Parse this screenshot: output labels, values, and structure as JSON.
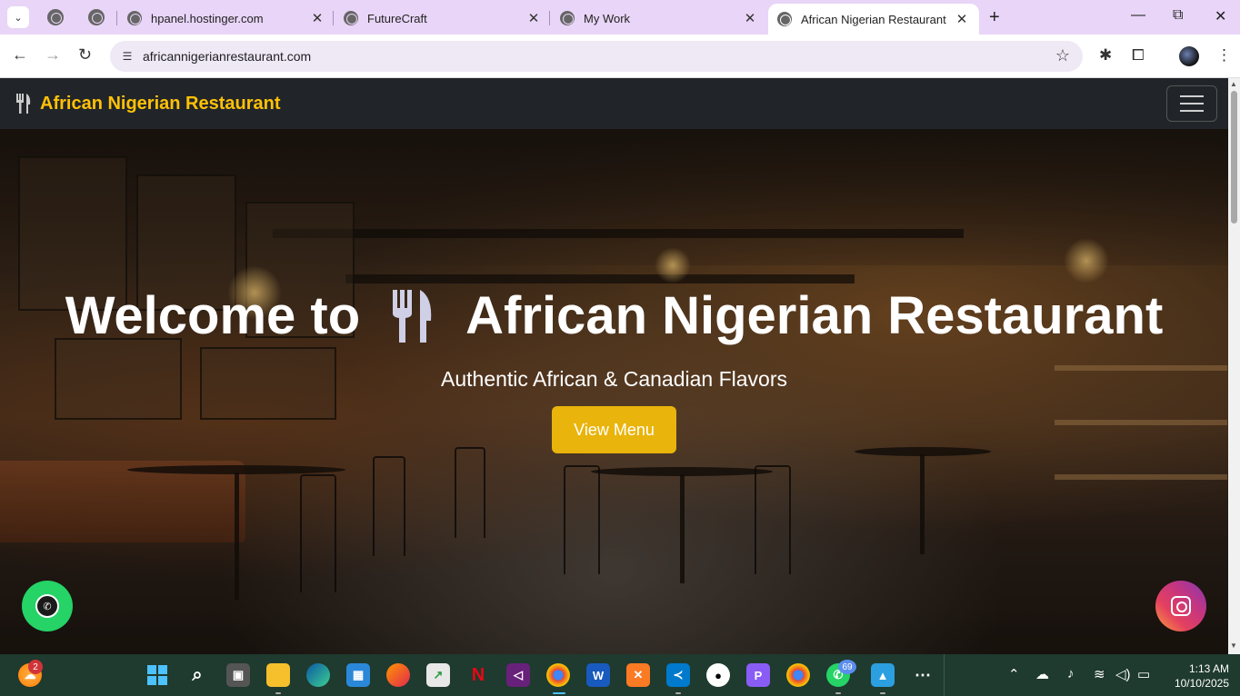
{
  "browser": {
    "tabs": [
      {
        "label": "hpanel.hostinger.com",
        "active": false
      },
      {
        "label": "FutureCraft",
        "active": false
      },
      {
        "label": "My Work",
        "active": false
      },
      {
        "label": "African Nigerian Restaurant",
        "active": true
      }
    ],
    "url": "africannigerianrestaurant.com"
  },
  "site": {
    "brand": "African Nigerian Restaurant",
    "hero": {
      "title_pre": "Welcome to",
      "title_post": "African Nigerian Restaurant",
      "subtitle": "Authentic African & Canadian Flavors",
      "button": "View Menu"
    },
    "colors": {
      "brand": "#ffc107",
      "button": "#e9b40b",
      "nav": "#212529",
      "whatsapp": "#25d366"
    }
  },
  "taskbar": {
    "badges": {
      "weather": "2",
      "whatsapp": "69"
    },
    "clock": {
      "time": "1:13 AM",
      "date": "10/10/2025"
    }
  }
}
